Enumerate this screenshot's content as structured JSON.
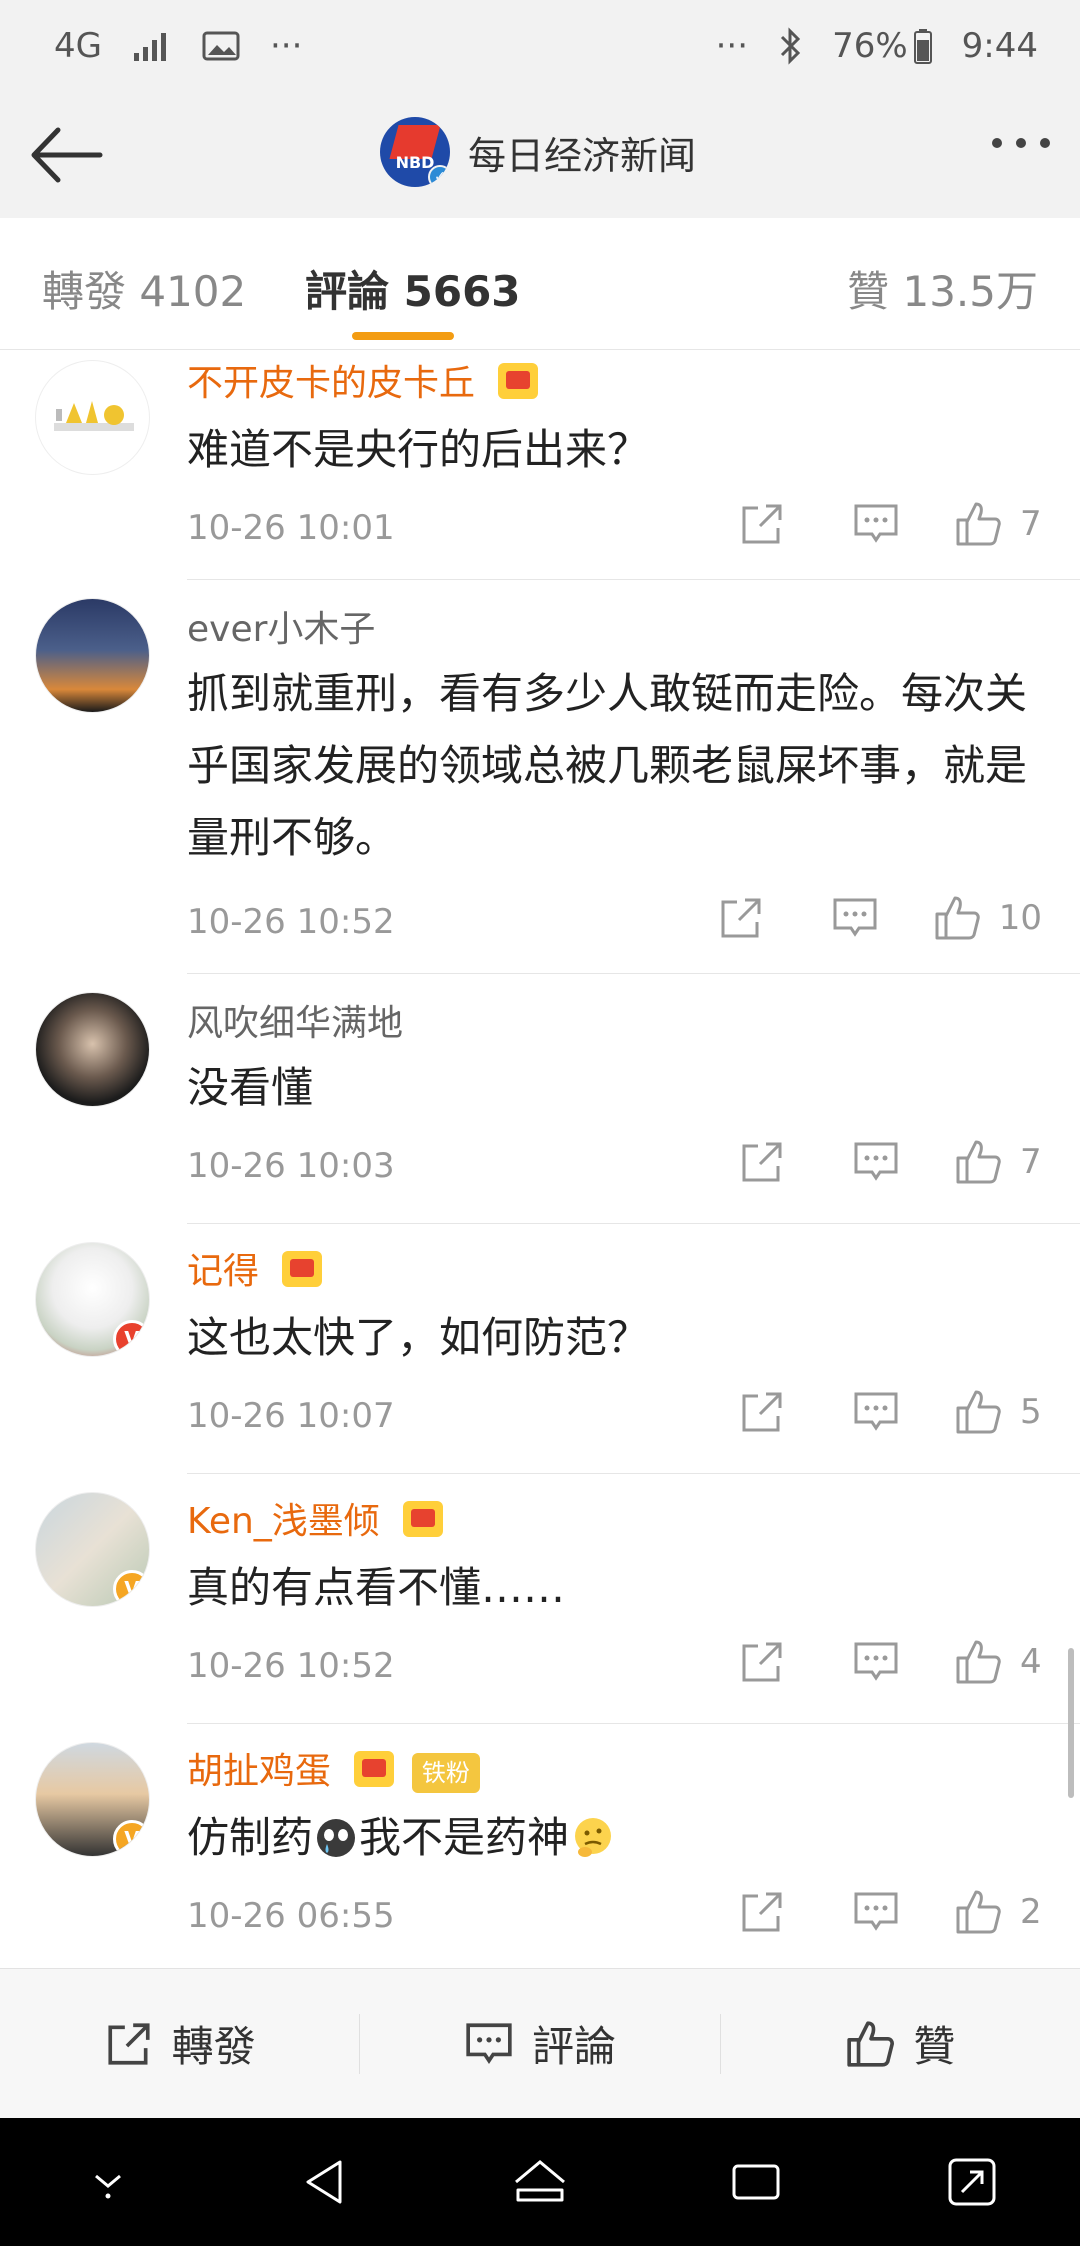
{
  "status_bar": {
    "network": "4G",
    "battery": "76%",
    "time": "9:44",
    "left_more": "···",
    "right_more": "···"
  },
  "header": {
    "title": "每日经济新闻",
    "logo_text": "NBD"
  },
  "tabs": {
    "repost": "轉發 4102",
    "comment": "評論 5663",
    "like": "贊 13.5万"
  },
  "comments": [
    {
      "name": "不开皮卡的皮卡丘",
      "vip": true,
      "text": "难道不是央行的后出来？",
      "time": "10-26 10:01",
      "likes": "7"
    },
    {
      "name": "ever小木子",
      "vip": false,
      "text": "抓到就重刑，看有多少人敢铤而走险。每次关乎国家发展的领域总被几颗老鼠屎坏事，就是量刑不够。",
      "time": "10-26 10:52",
      "likes": "10"
    },
    {
      "name": "风吹细华满地",
      "vip": false,
      "text": "没看懂",
      "time": "10-26 10:03",
      "likes": "7"
    },
    {
      "name": "记得",
      "vip": true,
      "text": "这也太快了，如何防范？",
      "time": "10-26 10:07",
      "likes": "5"
    },
    {
      "name": "Ken_浅墨倾",
      "vip": true,
      "text": "真的有点看不懂……",
      "time": "10-26 10:52",
      "likes": "4"
    },
    {
      "name": "胡扯鸡蛋",
      "vip": true,
      "fan_tag": "铁粉",
      "text_a": "仿制药",
      "text_b": "我不是药神",
      "time": "10-26 06:55",
      "likes": "2"
    }
  ],
  "toolbar": {
    "repost": "轉發",
    "comment": "評論",
    "like": "贊"
  },
  "colors": {
    "accent": "#f39c12",
    "vip_name": "#e8690e",
    "normal_name": "#666666",
    "meta": "#999999"
  }
}
